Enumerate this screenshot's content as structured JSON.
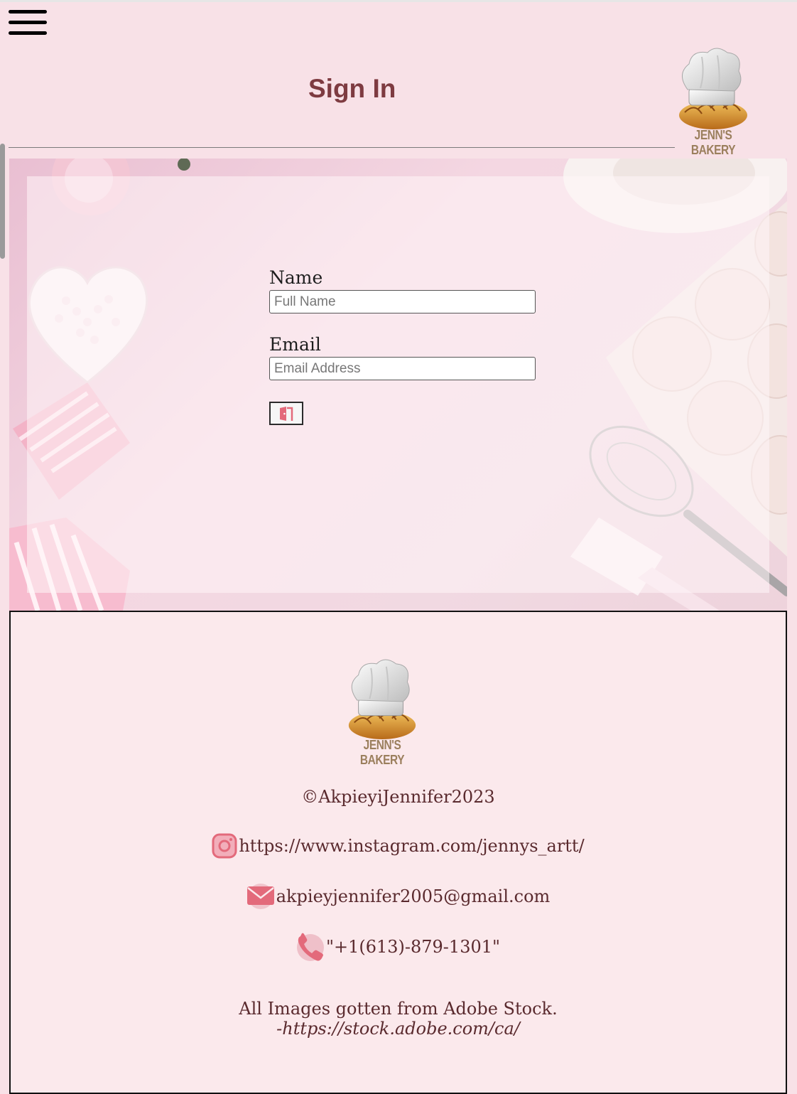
{
  "header": {
    "title": "Sign In",
    "logo_text": "JENN'S BAKERY"
  },
  "form": {
    "name_label": "Name",
    "name_placeholder": "Full Name",
    "email_label": "Email",
    "email_placeholder": "Email Address",
    "submit_icon": "door-enter-icon"
  },
  "footer": {
    "logo_text": "JENN'S BAKERY",
    "copyright": "©AkpieyiJennifer2023",
    "instagram": "https://www.instagram.com/jennys_artt/",
    "email": "akpieyjennifer2005@gmail.com",
    "phone": "\"+1(613)-879-1301\"",
    "credits_line": "All Images gotten from Adobe Stock.",
    "credits_url": "-https://stock.adobe.com/ca/"
  },
  "colors": {
    "background": "#f8e1e7",
    "title": "#7e3b41",
    "accent_icon": "#e36a7b",
    "footer_bg": "#fbe9ec"
  }
}
